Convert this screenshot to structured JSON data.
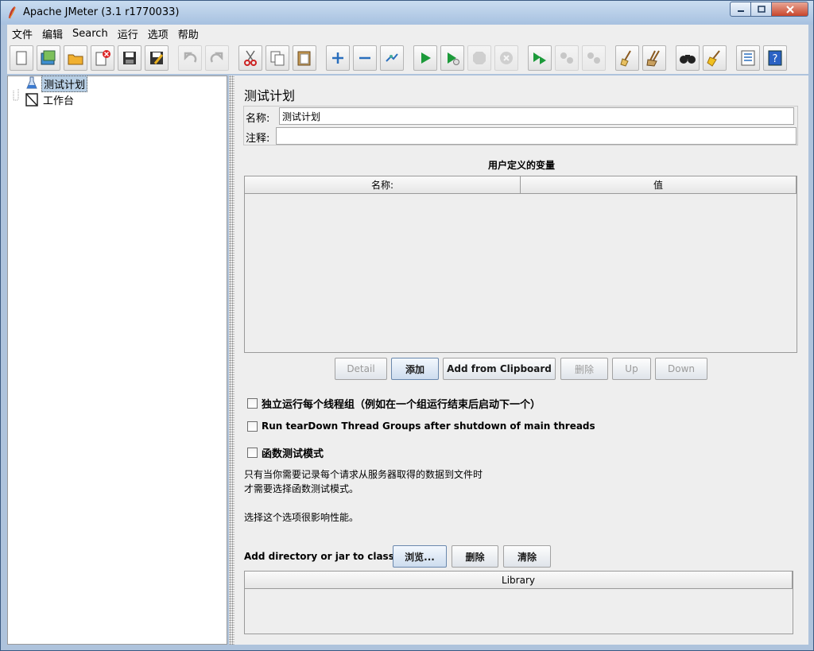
{
  "window": {
    "title": "Apache JMeter (3.1 r1770033)"
  },
  "menubar": {
    "items": [
      "文件",
      "编辑",
      "Search",
      "运行",
      "选项",
      "帮助"
    ]
  },
  "toolbar": {
    "buttons": [
      {
        "icon": "new-icon",
        "enabled": true
      },
      {
        "icon": "templates-icon",
        "enabled": true
      },
      {
        "icon": "open-icon",
        "enabled": true
      },
      {
        "icon": "close-file-icon",
        "enabled": true
      },
      {
        "icon": "save-icon",
        "enabled": true
      },
      {
        "icon": "save-as-icon",
        "enabled": true
      },
      {
        "icon": "undo-icon",
        "enabled": false
      },
      {
        "icon": "redo-icon",
        "enabled": false
      },
      {
        "icon": "cut-icon",
        "enabled": true
      },
      {
        "icon": "copy-icon",
        "enabled": true
      },
      {
        "icon": "paste-icon",
        "enabled": true
      },
      {
        "icon": "expand-icon",
        "enabled": true
      },
      {
        "icon": "collapse-icon",
        "enabled": true
      },
      {
        "icon": "toggle-icon",
        "enabled": true
      },
      {
        "icon": "start-icon",
        "enabled": true
      },
      {
        "icon": "start-no-pause-icon",
        "enabled": true
      },
      {
        "icon": "stop-icon",
        "enabled": false
      },
      {
        "icon": "shutdown-icon",
        "enabled": false
      },
      {
        "icon": "remote-start-icon",
        "enabled": true
      },
      {
        "icon": "remote-stop-icon",
        "enabled": false
      },
      {
        "icon": "remote-shutdown-icon",
        "enabled": false
      },
      {
        "icon": "clear-icon",
        "enabled": true
      },
      {
        "icon": "clear-all-icon",
        "enabled": true
      },
      {
        "icon": "search-icon",
        "enabled": true
      },
      {
        "icon": "reset-search-icon",
        "enabled": true
      },
      {
        "icon": "function-helper-icon",
        "enabled": true
      },
      {
        "icon": "help-icon",
        "enabled": true
      }
    ]
  },
  "tree": {
    "items": [
      {
        "label": "测试计划",
        "icon": "test-plan-icon",
        "selected": true
      },
      {
        "label": "工作台",
        "icon": "workbench-icon",
        "selected": false
      }
    ]
  },
  "panel": {
    "title": "测试计划",
    "name_label": "名称:",
    "name_value": "测试计划",
    "comment_label": "注释:",
    "comment_value": ""
  },
  "variables": {
    "title": "用户定义的变量",
    "columns": [
      "名称:",
      "值"
    ],
    "rows": [],
    "buttons": [
      {
        "label": "Detail",
        "enabled": false
      },
      {
        "label": "添加",
        "enabled": true
      },
      {
        "label": "Add from Clipboard",
        "enabled": true
      },
      {
        "label": "删除",
        "enabled": false
      },
      {
        "label": "Up",
        "enabled": false
      },
      {
        "label": "Down",
        "enabled": false
      }
    ]
  },
  "options": {
    "serialize": {
      "label": "独立运行每个线程组（例如在一个组运行结束后启动下一个）",
      "checked": false
    },
    "teardown": {
      "label": "Run tearDown Thread Groups after shutdown of main threads",
      "checked": false
    },
    "functional": {
      "label": "函数测试模式",
      "checked": false
    },
    "note_line1": "只有当你需要记录每个请求从服务器取得的数据到文件时",
    "note_line2": "才需要选择函数测试模式。",
    "note_line3": "选择这个选项很影响性能。"
  },
  "classpath": {
    "label": "Add directory or jar to classpath",
    "browse": "浏览...",
    "delete": "删除",
    "clear": "清除",
    "column": "Library"
  }
}
